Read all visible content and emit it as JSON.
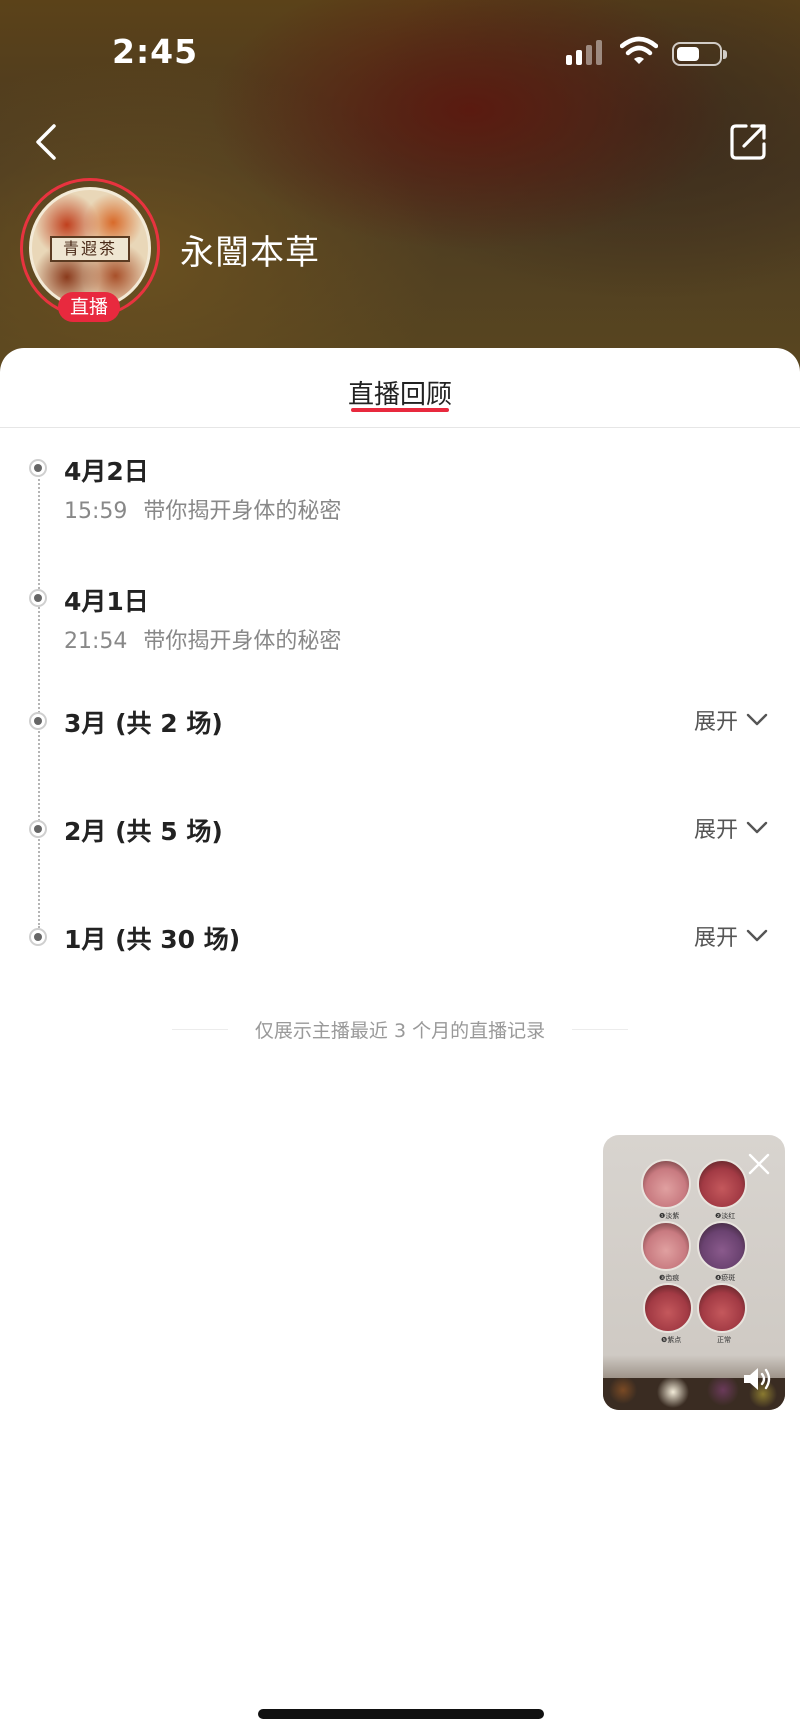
{
  "status_bar": {
    "time": "2:45"
  },
  "header": {
    "shop_name": "永闓本草",
    "avatar_text": "青遐茶",
    "live_badge": "直播"
  },
  "tab": {
    "title": "直播回顾"
  },
  "timeline": [
    {
      "date": "4月2日",
      "time": "15:59",
      "title": "带你揭开身体的秘密"
    },
    {
      "date": "4月1日",
      "time": "21:54",
      "title": "带你揭开身体的秘密"
    },
    {
      "date": "3月 (共 2 场)",
      "expand_label": "展开"
    },
    {
      "date": "2月 (共 5 场)",
      "expand_label": "展开"
    },
    {
      "date": "1月 (共 30 场)",
      "expand_label": "展开"
    }
  ],
  "footnote": "仅展示主播最近 3 个月的直播记录",
  "floating_video": {
    "labels": [
      "❶淡紫",
      "❷淡红",
      "❸齿痕",
      "❹瘀斑",
      "❺紫点",
      "正常"
    ]
  },
  "colors": {
    "accent": "#e8293e",
    "header_bg": "#5b4219"
  }
}
